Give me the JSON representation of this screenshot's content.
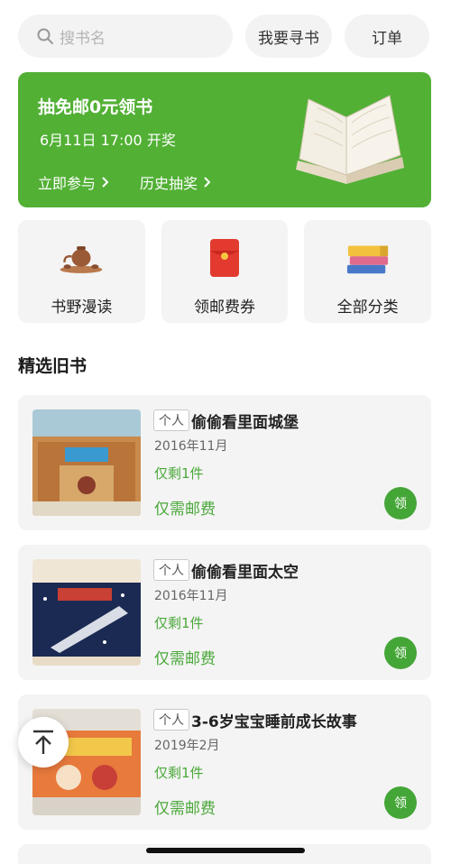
{
  "search": {
    "placeholder": "搜书名"
  },
  "header": {
    "seek_label": "我要寻书",
    "order_label": "订单"
  },
  "banner": {
    "title": "抽免邮0元领书",
    "subtitle": "6月11日 17:00 开奖",
    "join_label": "立即参与",
    "history_label": "历史抽奖",
    "bg_color": "#52b035"
  },
  "quick": [
    {
      "label": "书野漫读",
      "icon": "teapot-icon"
    },
    {
      "label": "领邮费券",
      "icon": "red-envelope-icon"
    },
    {
      "label": "全部分类",
      "icon": "book-stack-icon"
    }
  ],
  "section": {
    "title": "精选旧书"
  },
  "books": [
    {
      "tag": "个人",
      "title": "偷偷看里面城堡",
      "date": "2016年11月",
      "stock": "仅剩1件",
      "fee": "仅需邮费",
      "claim": "领"
    },
    {
      "tag": "个人",
      "title": "偷偷看里面太空",
      "date": "2016年11月",
      "stock": "仅剩1件",
      "fee": "仅需邮费",
      "claim": "领"
    },
    {
      "tag": "个人",
      "title": "3-6岁宝宝睡前成长故事",
      "date": "2019年2月",
      "stock": "仅剩1件",
      "fee": "仅需邮费",
      "claim": "领"
    }
  ],
  "accent_color": "#4aa83a"
}
